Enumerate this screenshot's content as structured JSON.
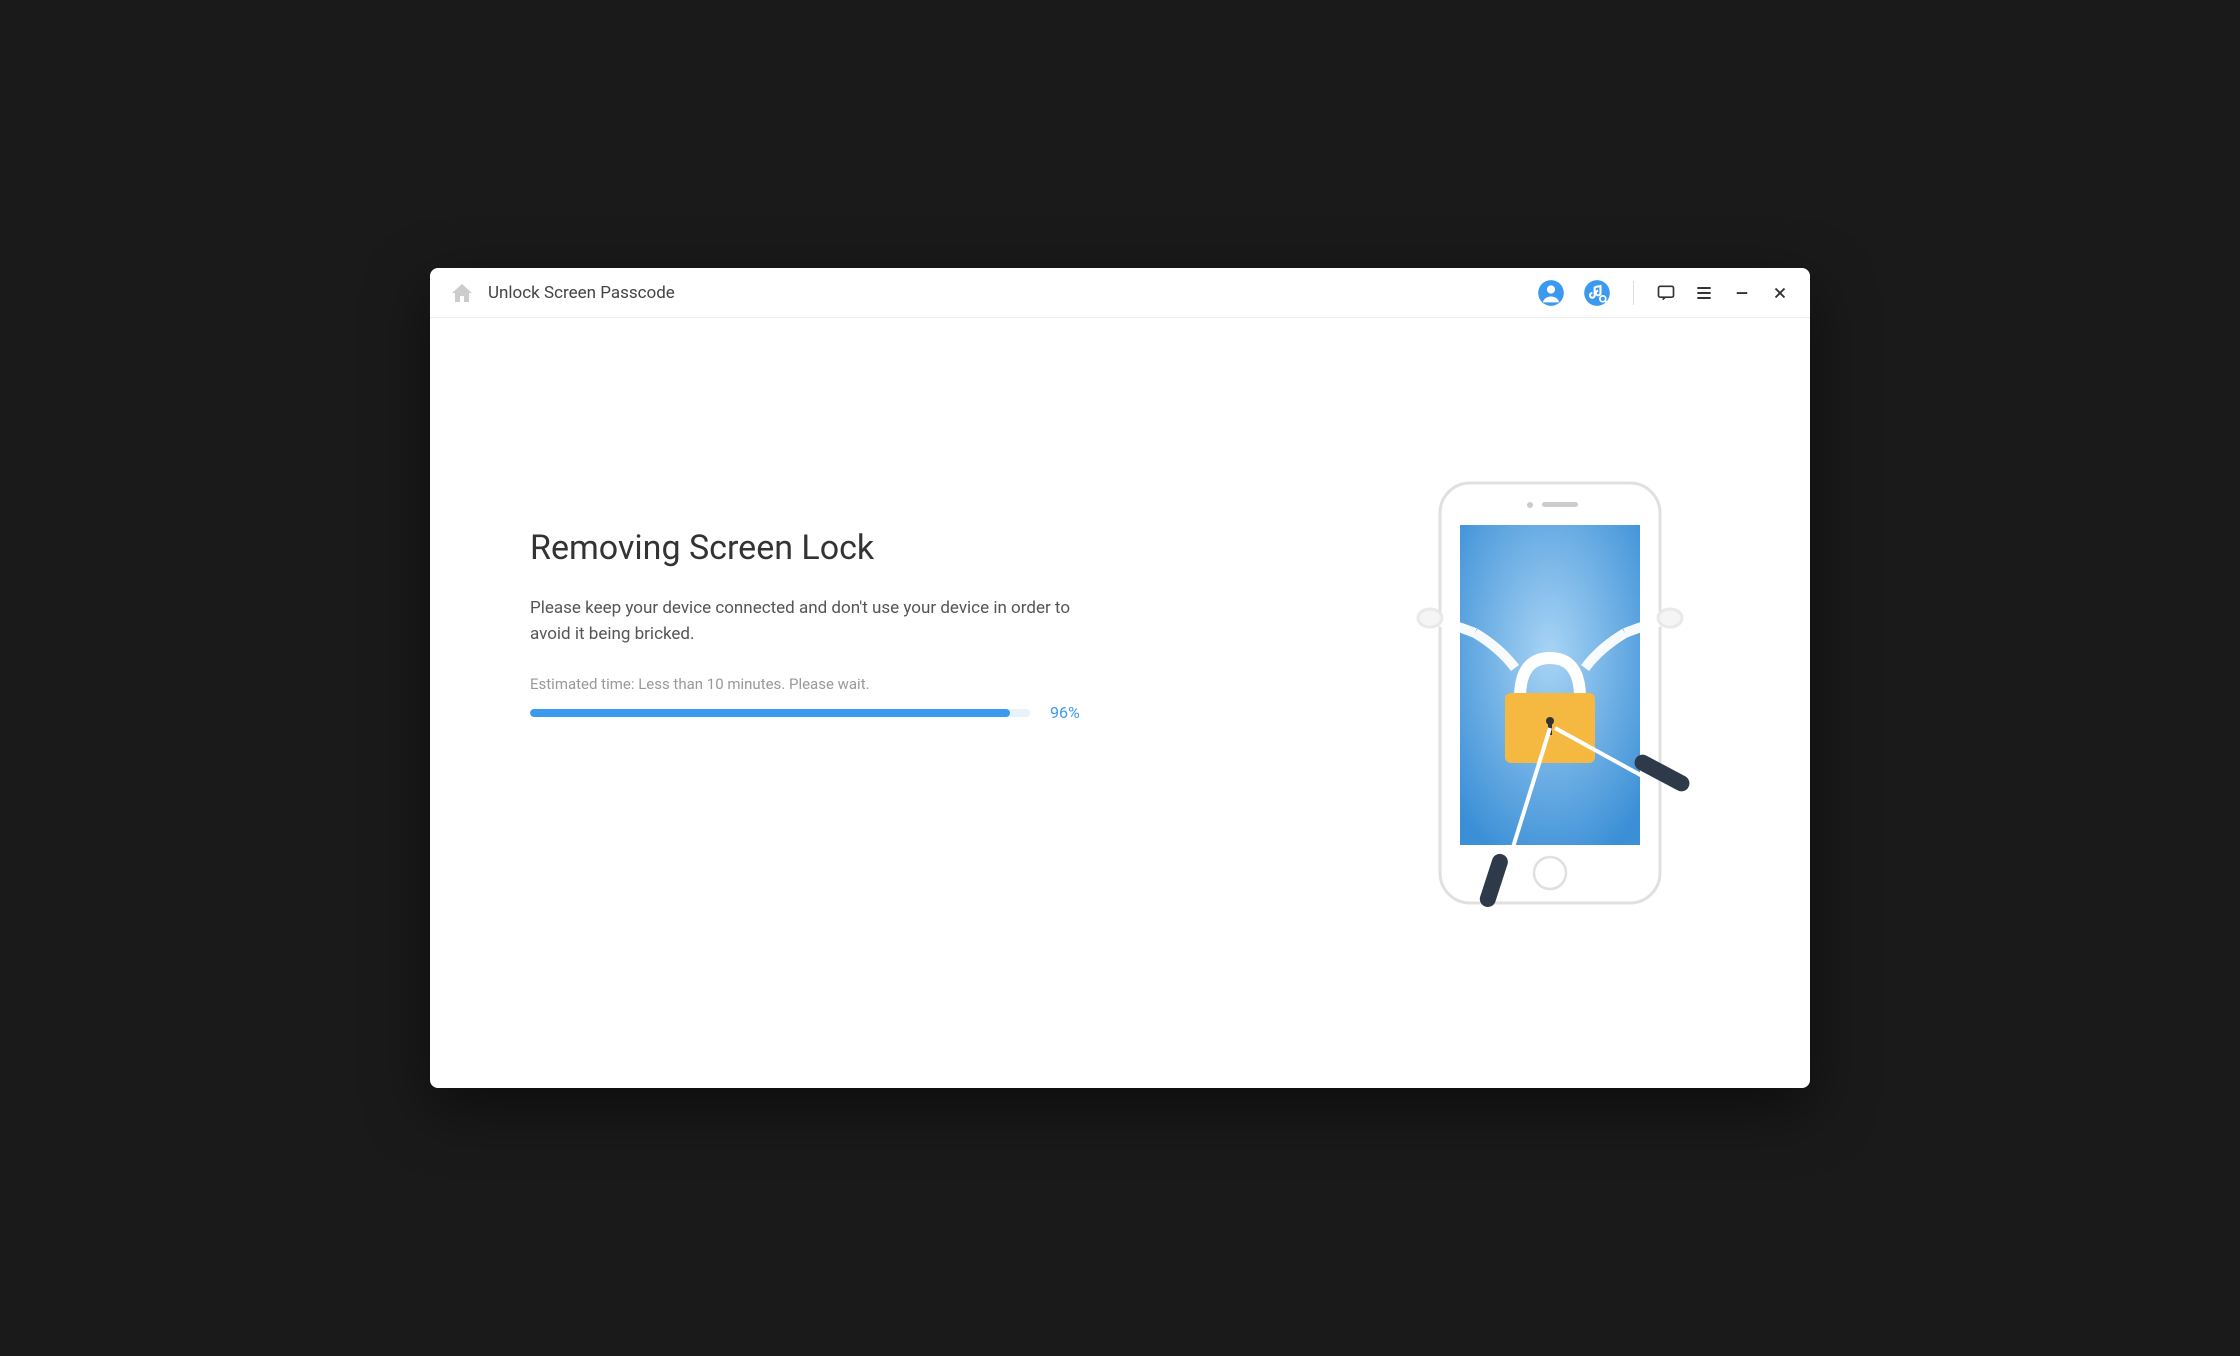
{
  "window": {
    "title": "Unlock Screen Passcode"
  },
  "main": {
    "heading": "Removing Screen Lock",
    "description": "Please keep your device connected and don't use your device in order to avoid it being bricked.",
    "estimate": "Estimated time: Less than 10 minutes. Please wait.",
    "progress_percent": 96,
    "progress_label": "96%"
  },
  "colors": {
    "accent": "#3b99f0",
    "progress_bg": "#e8f2fb"
  }
}
